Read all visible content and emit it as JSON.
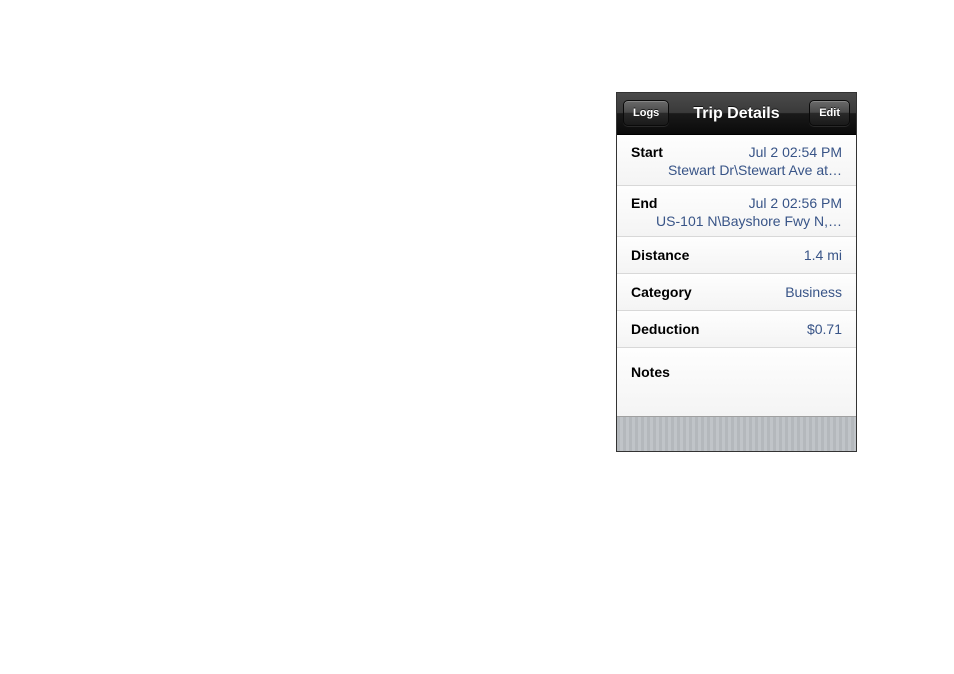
{
  "nav": {
    "back_label": "Logs",
    "title": "Trip Details",
    "edit_label": "Edit"
  },
  "rows": {
    "start": {
      "label": "Start",
      "time": "Jul 2 02:54 PM",
      "location": "Stewart Dr\\Stewart Ave at…"
    },
    "end": {
      "label": "End",
      "time": "Jul 2 02:56 PM",
      "location": "US-101 N\\Bayshore Fwy N,…"
    },
    "distance": {
      "label": "Distance",
      "value": "1.4 mi"
    },
    "category": {
      "label": "Category",
      "value": "Business"
    },
    "deduction": {
      "label": "Deduction",
      "value": "$0.71"
    },
    "notes": {
      "label": "Notes",
      "value": ""
    }
  }
}
